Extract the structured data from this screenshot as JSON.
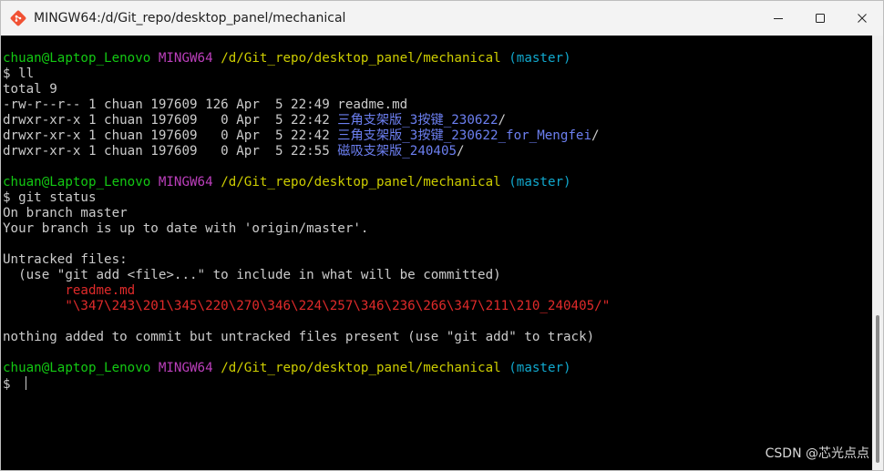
{
  "window": {
    "title": "MINGW64:/d/Git_repo/desktop_panel/mechanical",
    "icon": "git-bash-icon",
    "controls": [
      "minimize-icon",
      "maximize-icon",
      "close-icon"
    ]
  },
  "colors": {
    "prompt_user": "#13c913",
    "prompt_env": "#bc3fbc",
    "prompt_path": "#cdcd00",
    "prompt_branch": "#11a8cd",
    "directory": "#6c7ff0",
    "untracked": "#e02a2a",
    "default_text": "#cccccc",
    "background": "#000000"
  },
  "terminal": {
    "prompt": {
      "user": "chuan@Laptop_Lenovo",
      "env": "MINGW64",
      "path": "/d/Git_repo/desktop_panel/mechanical",
      "branch": "(master)"
    },
    "ll": {
      "command": "$ ll",
      "total": "total 9",
      "rows": [
        {
          "meta": "-rw-r--r-- 1 chuan 197609 126 Apr  5 22:49 ",
          "name": "readme.md",
          "suffix": ""
        },
        {
          "meta": "drwxr-xr-x 1 chuan 197609   0 Apr  5 22:42 ",
          "name": "三角支架版_3按键_230622",
          "suffix": "/"
        },
        {
          "meta": "drwxr-xr-x 1 chuan 197609   0 Apr  5 22:42 ",
          "name": "三角支架版_3按键_230622_for_Mengfei",
          "suffix": "/"
        },
        {
          "meta": "drwxr-xr-x 1 chuan 197609   0 Apr  5 22:55 ",
          "name": "磁吸支架版_240405",
          "suffix": "/"
        }
      ]
    },
    "status": {
      "command": "$ git status",
      "lines": [
        "On branch master",
        "Your branch is up to date with 'origin/master'.",
        "",
        "Untracked files:",
        "  (use \"git add <file>...\" to include in what will be committed)"
      ],
      "untracked": [
        "        readme.md",
        "        \"\\347\\243\\201\\345\\220\\270\\346\\224\\257\\346\\236\\266\\347\\211\\210_240405/\""
      ],
      "footer": "nothing added to commit but untracked files present (use \"git add\" to track)"
    },
    "final_prompt": "$ "
  },
  "watermark": "CSDN @芯光点点"
}
